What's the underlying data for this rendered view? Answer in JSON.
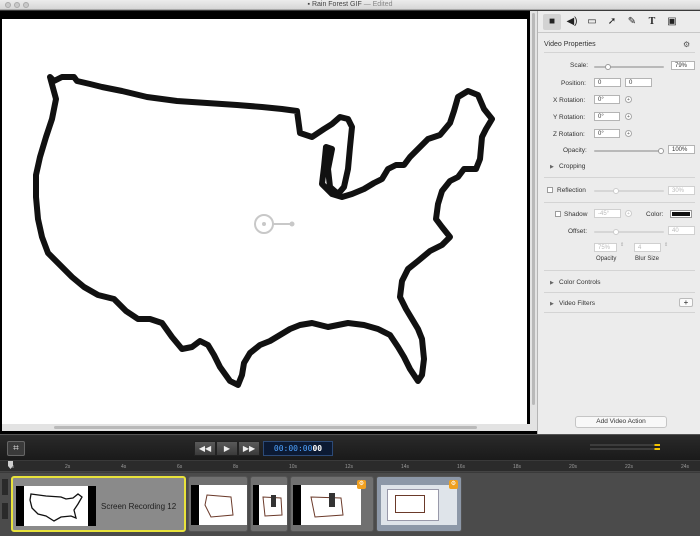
{
  "window": {
    "title": "Rain Forest GIF",
    "edited": "— Edited"
  },
  "inspector": {
    "tabs": [
      "video-properties",
      "audio",
      "screen",
      "cursor",
      "annotation",
      "text",
      "media"
    ],
    "heading": "Video Properties",
    "scale_label": "Scale:",
    "scale_value": "79%",
    "position_label": "Position:",
    "position_x": "0",
    "position_y": "0",
    "x_rotation_label": "X Rotation:",
    "x_rotation": "0°",
    "y_rotation_label": "Y Rotation:",
    "y_rotation": "0°",
    "z_rotation_label": "Z Rotation:",
    "z_rotation": "0°",
    "opacity_label": "Opacity:",
    "opacity_value": "100%",
    "cropping_label": "Cropping",
    "reflection_label": "Reflection",
    "reflection_value": "30%",
    "shadow_label": "Shadow",
    "shadow_angle": "-45°",
    "color_label": "Color:",
    "offset_label": "Offset:",
    "offset_value": "40",
    "shadow_opacity": "75%",
    "shadow_blur": "4",
    "opacity_caption": "Opacity",
    "blur_caption": "Blur Size",
    "color_controls_label": "Color Controls",
    "video_filters_label": "Video Filters",
    "add_action_label": "Add Video Action",
    "colors": {
      "shadow": "#111111"
    }
  },
  "transport": {
    "timecode_prefix": "00:00:00",
    "timecode_frames": "00",
    "rewind_icon": "◀◀",
    "play_icon": "▶",
    "forward_icon": "▶▶"
  },
  "ruler": {
    "ticks": [
      "0s",
      "2s",
      "4s",
      "6s",
      "8s",
      "10s",
      "12s",
      "14s",
      "16s",
      "18s",
      "20s",
      "22s",
      "24s"
    ]
  },
  "timeline": {
    "clips": [
      {
        "label": "Screen Recording 12"
      }
    ]
  }
}
